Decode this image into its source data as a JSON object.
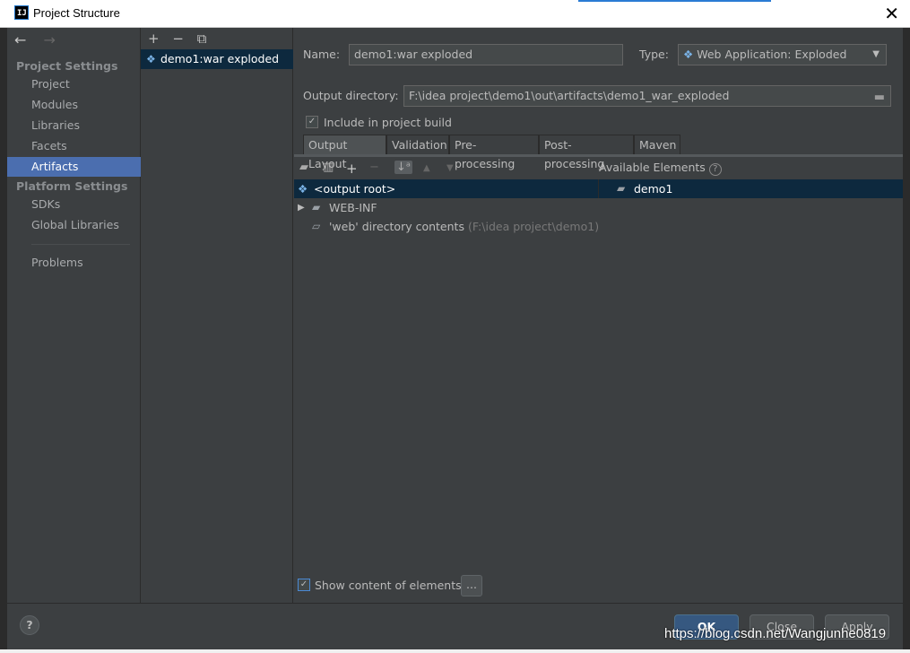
{
  "window": {
    "title": "Project Structure",
    "close_glyph": "✕"
  },
  "nav": {
    "back_glyph": "←",
    "forward_glyph": "→"
  },
  "sidebar": {
    "project_settings_title": "Project Settings",
    "platform_settings_title": "Platform Settings",
    "items": [
      {
        "label": "Project"
      },
      {
        "label": "Modules"
      },
      {
        "label": "Libraries"
      },
      {
        "label": "Facets"
      },
      {
        "label": "Artifacts",
        "selected": true
      },
      {
        "label": "SDKs"
      },
      {
        "label": "Global Libraries"
      },
      {
        "label": "Problems"
      }
    ]
  },
  "artifacts": {
    "toolbar": {
      "add": "+",
      "remove": "−",
      "copy": "⧉"
    },
    "items": [
      {
        "label": "demo1:war exploded",
        "icon": "web-artifact-icon"
      }
    ]
  },
  "form": {
    "name_label": "Name:",
    "name_value": "demo1:war exploded",
    "type_label": "Type:",
    "type_value": "Web Application: Exploded",
    "output_dir_label": "Output directory:",
    "output_dir_value": "F:\\idea project\\demo1\\out\\artifacts\\demo1_war_exploded",
    "include_build_label": "Include in project build",
    "include_build_checked": true
  },
  "tabs": [
    {
      "label": "Output Layout",
      "active": true
    },
    {
      "label": "Validation"
    },
    {
      "label": "Pre-processing"
    },
    {
      "label": "Post-processing"
    },
    {
      "label": "Maven"
    }
  ],
  "layout": {
    "available_elements_label": "Available Elements",
    "tree": [
      {
        "label": "<output root>",
        "selected": true
      },
      {
        "label": "WEB-INF",
        "expandable": true
      },
      {
        "label": "'web' directory contents",
        "hint": "(F:\\idea project\\demo1)"
      }
    ],
    "available": [
      {
        "label": "demo1"
      }
    ],
    "show_content_label": "Show content of elements",
    "show_content_checked": true,
    "ellipsis_label": "..."
  },
  "footer": {
    "help_label": "?",
    "ok_label": "OK",
    "close_label": "Close",
    "apply_label": "Apply"
  },
  "watermark": "https://blog.csdn.net/Wangjunhe0819",
  "colors": {
    "selection": "#0d293e",
    "sidebar_selected": "#4b6eaf",
    "background": "#3c3f41"
  }
}
